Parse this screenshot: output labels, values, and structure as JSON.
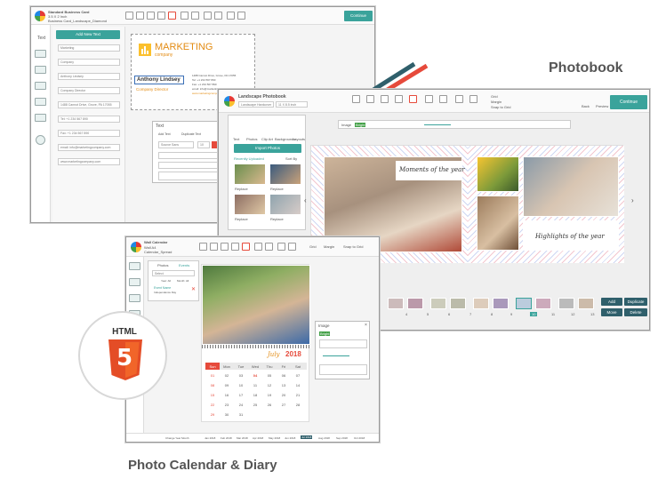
{
  "labels": {
    "photobook": "Photobook",
    "calendar": "Photo Calendar & Diary",
    "html_badge": "HTML",
    "html_digit": "5"
  },
  "business_card": {
    "title_line1": "Standard Business Card",
    "title_line2": "3.5 X 2 Inch",
    "title_line3": "Business Card_Landscape_Diamond",
    "sidebar": [
      "Text",
      "Images",
      "Shapes",
      "Stickers",
      "Backgrounds",
      "Templates",
      "Help"
    ],
    "add_text_button": "Add New Text",
    "fields": [
      "Marketing",
      "Company",
      "Anthony Lindsey",
      "Company Director",
      "1488 Cannot Drive, Grove, PA 17055",
      "Tel: +1 234 567 890",
      "Fax: +1 234 567 890",
      "email: info@marketingcompany.com",
      "www.marketingcompany.com"
    ],
    "card_brand": "MARKETING",
    "card_brand_sub": "company",
    "card_name": "Anthony Lindsey",
    "card_role": "Company Director",
    "card_address": "1488 Cannot Drive, Grove, PA 17055",
    "card_tel": "Tel: +1 234 567 890",
    "card_fax": "Fax: +1 234 567 890",
    "card_email": "email: info@marketingcompany.com",
    "card_web": "www.marketingcompany.com",
    "text_panel_title": "Text",
    "text_panel_add": "Add Text",
    "text_panel_dup": "Duplicate Text",
    "text_panel_font": "Source Sans",
    "text_panel_size": "10",
    "continue": "Continue"
  },
  "photobook": {
    "title": "Landscape Photobook",
    "subtitle": "Landscape Hardcover",
    "size": "11 X 8.5 inch",
    "toolbar": [
      "Add Photo",
      "Cut",
      "Copy",
      "Paste",
      "Delete",
      "Undo",
      "Redo",
      "Zoom In",
      "Zoom Out"
    ],
    "checks": [
      "Grid",
      "Margin",
      "Snap to Grid"
    ],
    "back": "Back",
    "preview": "Preview",
    "continue": "Continue",
    "tabs": [
      "Text",
      "Photos",
      "Clip Art",
      "Backgrounds",
      "Layouts"
    ],
    "import_button": "Import Photos",
    "recently_uploaded": "Recently Uploaded",
    "sort": "Sort By",
    "replace": "Replace",
    "image_bar_label": "Image",
    "image_bar_flag": "Bright",
    "left_page_caption": "Moments of the year",
    "right_page_caption": "Highlights of the year",
    "page_numbers": [
      "4",
      "5",
      "6",
      "7",
      "8",
      "9",
      "10",
      "11",
      "12",
      "13"
    ],
    "actions": [
      "Add",
      "Duplicate",
      "Move",
      "Delete"
    ]
  },
  "calendar": {
    "title": "Wall Calendar",
    "subtitle": "Wall A4",
    "sub2": "Calendar_Spread",
    "toolbar_right": [
      "Grid",
      "Margin",
      "Snap to Grid"
    ],
    "tabs": [
      "Photos",
      "Events"
    ],
    "select_label": "Select",
    "select_hint": "Year: All",
    "select_hint2": "Month: All",
    "event_label": "Event Name",
    "event_sub": "Independence Day",
    "month": "July",
    "year": "2018",
    "weekdays": [
      "Sun",
      "Mon",
      "Tue",
      "Wed",
      "Thu",
      "Fri",
      "Sat"
    ],
    "weeks": [
      [
        "",
        "01",
        "02",
        "03",
        "04",
        "05",
        "06",
        "07"
      ],
      [
        "",
        "08",
        "09",
        "10",
        "11",
        "12",
        "13",
        "14"
      ],
      [
        "",
        "15",
        "16",
        "17",
        "18",
        "19",
        "20",
        "21"
      ],
      [
        "",
        "22",
        "23",
        "24",
        "25",
        "26",
        "27",
        "28"
      ],
      [
        "",
        "29",
        "30",
        "31",
        "",
        "",
        "",
        ""
      ]
    ],
    "image_panel_title": "Image",
    "image_panel_flag": "Bright",
    "months_strip": [
      "Jan 2018",
      "Feb 2018",
      "Mar 2018",
      "Apr 2018",
      "May 2018",
      "Jun 2018",
      "Jul 2018",
      "Aug 2018",
      "Sep 2018",
      "Oct 2018"
    ],
    "current_month_chip": "Jul 2018",
    "bottom_left": "Change Year Month"
  },
  "colors": {
    "teal": "#3aa39b",
    "accent_red": "#e64a3b",
    "html5_orange": "#e44d26",
    "label_gray": "#555555"
  }
}
